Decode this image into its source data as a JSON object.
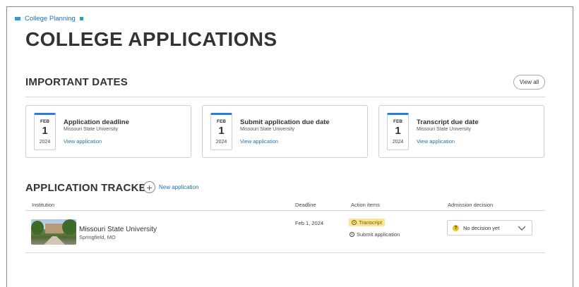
{
  "breadcrumb": {
    "label": "College Planning"
  },
  "page": {
    "title": "COLLEGE APPLICATIONS"
  },
  "important_dates": {
    "title": "IMPORTANT DATES",
    "view_all_label": "View all",
    "cards": [
      {
        "month": "FEB",
        "day": "1",
        "year": "2024",
        "title": "Application deadline",
        "institution": "Missouri State University",
        "link": "View application"
      },
      {
        "month": "FEB",
        "day": "1",
        "year": "2024",
        "title": "Submit application due date",
        "institution": "Missouri State University",
        "link": "View application"
      },
      {
        "month": "FEB",
        "day": "1",
        "year": "2024",
        "title": "Transcript due date",
        "institution": "Missouri State University",
        "link": "View application"
      }
    ]
  },
  "tracker": {
    "title": "APPLICATION TRACKER",
    "new_application_label": "New application",
    "columns": {
      "institution": "Institution",
      "deadline": "Deadline",
      "action_items": "Action items",
      "admission_decision": "Admission decision"
    },
    "rows": [
      {
        "institution_name": "Missouri State University",
        "location": "Springfield, MO",
        "deadline": "Feb 1, 2024",
        "action_items": [
          "Transcript",
          "Submit application"
        ],
        "decision": "No decision yet"
      }
    ]
  },
  "colors": {
    "accent": "#2a7fd0",
    "link": "#1f6fb2",
    "highlight": "#fbe58a",
    "warning": "#f2c318"
  }
}
